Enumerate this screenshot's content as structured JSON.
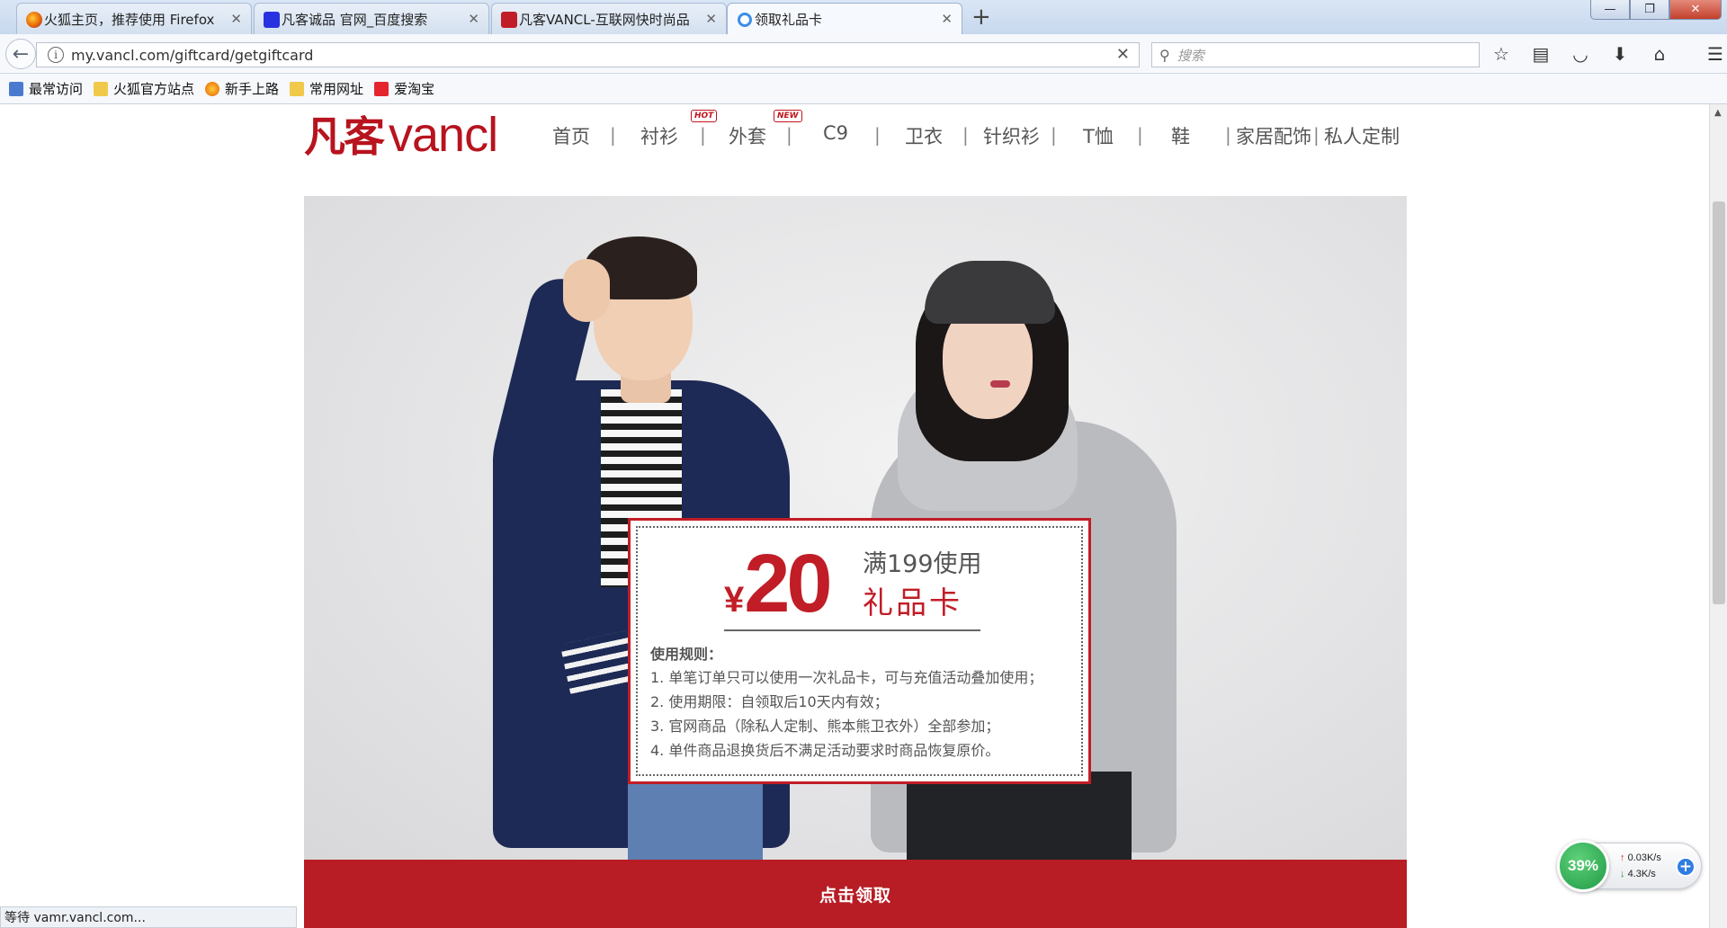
{
  "browser": {
    "tabs": [
      {
        "title": "火狐主页，推荐使用 Firefox",
        "icon": "firefox-icon",
        "color": "#e66000",
        "active": false
      },
      {
        "title": "凡客诚品 官网_百度搜索",
        "icon": "baidu-paw-icon",
        "color": "#2932e1",
        "active": false
      },
      {
        "title": "凡客VANCL-互联网快时尚品",
        "icon": "vancl-icon",
        "color": "#c11d26",
        "active": false
      },
      {
        "title": "领取礼品卡",
        "icon": "loading-icon",
        "color": "#3d8ee8",
        "active": true
      }
    ],
    "new_tab": "+",
    "window": {
      "minimize": "—",
      "restore": "❐",
      "close": "✕"
    },
    "url": "my.vancl.com/giftcard/getgiftcard",
    "search_placeholder": "搜索",
    "bookmarks": [
      {
        "label": "最常访问",
        "icon": "most-visited-icon",
        "color": "#4a7bd1"
      },
      {
        "label": "火狐官方站点",
        "icon": "folder-icon",
        "color": "#f0c94a"
      },
      {
        "label": "新手上路",
        "icon": "firefox-icon",
        "color": "#e66000"
      },
      {
        "label": "常用网址",
        "icon": "folder-icon",
        "color": "#f0c94a"
      },
      {
        "label": "爱淘宝",
        "icon": "taobao-icon",
        "color": "#e4242e"
      }
    ],
    "status_text": "等待 vamr.vancl.com..."
  },
  "site": {
    "logo_cn": "凡客",
    "logo_en": "vancl",
    "brand_color": "#b8131e",
    "nav": [
      {
        "label": "首页"
      },
      {
        "label": "衬衫",
        "badge": "HOT"
      },
      {
        "label": "外套",
        "badge": "NEW"
      },
      {
        "label": "C9"
      },
      {
        "label": "卫衣"
      },
      {
        "label": "针织衫"
      },
      {
        "label": "T恤"
      },
      {
        "label": "鞋"
      },
      {
        "label": "家居配饰"
      },
      {
        "label": "私人定制"
      }
    ],
    "separator": "|"
  },
  "giftcard": {
    "currency": "¥",
    "amount": "20",
    "condition": "满199使用",
    "name": "礼品卡",
    "rules_title": "使用规则：",
    "rules": [
      "1. 单笔订单只可以使用一次礼品卡，可与充值活动叠加使用；",
      "2. 使用期限：自领取后10天内有效；",
      "3. 官网商品（除私人定制、熊本熊卫衣外）全部参加；",
      "4. 单件商品退换货后不满足活动要求时商品恢复原价。"
    ],
    "claim_label": "点击领取"
  },
  "net_widget": {
    "percent": "39%",
    "up": "0.03K/s",
    "down": "4.3K/s",
    "plus": "+"
  }
}
